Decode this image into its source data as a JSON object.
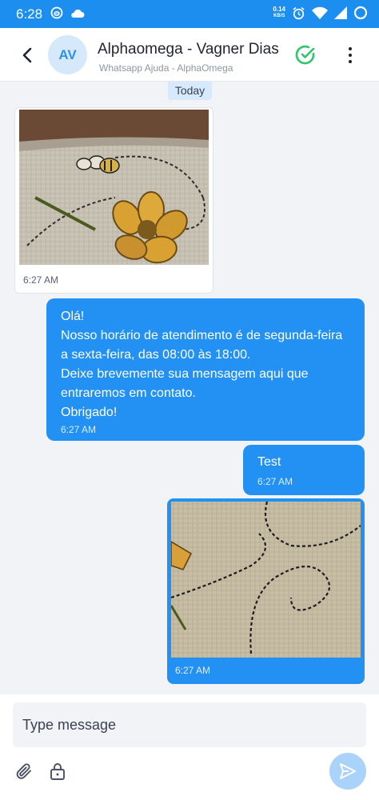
{
  "status_bar": {
    "time": "6:28",
    "net_speed_value": "0.14",
    "net_speed_unit": "KB/S"
  },
  "header": {
    "avatar_initials": "AV",
    "contact_name": "Alphaomega - Vagner Dias",
    "inbox_name": "Whatsapp Ajuda - AlphaOmega",
    "icons": {
      "back": "chevron-left-icon",
      "resolve": "check-circle-icon",
      "more": "more-vertical-icon"
    },
    "colors": {
      "resolve": "#2ec56b",
      "brand": "#1c8ef0"
    }
  },
  "chat": {
    "date_divider": "Today",
    "messages": [
      {
        "direction": "incoming",
        "type": "image",
        "time": "6:27 AM"
      },
      {
        "direction": "outgoing",
        "type": "text",
        "lines": [
          "Olá!",
          "Nosso horário de atendimento é de segunda-feira",
          "a sexta-feira, das 08:00 às 18:00.",
          "Deixe brevemente sua mensagem aqui que",
          "entraremos em contato.",
          "Obrigado!"
        ],
        "time": "6:27 AM"
      },
      {
        "direction": "outgoing",
        "type": "text",
        "lines": [
          "Test"
        ],
        "time": "6:27 AM"
      },
      {
        "direction": "outgoing",
        "type": "image",
        "time": "6:27 AM"
      }
    ],
    "colors": {
      "outgoing_bubble": "#2391f3",
      "incoming_bubble": "#ffffff"
    }
  },
  "composer": {
    "placeholder": "Type message",
    "icons": {
      "attach": "paperclip-icon",
      "private_note": "lock-icon",
      "send": "send-icon"
    }
  }
}
